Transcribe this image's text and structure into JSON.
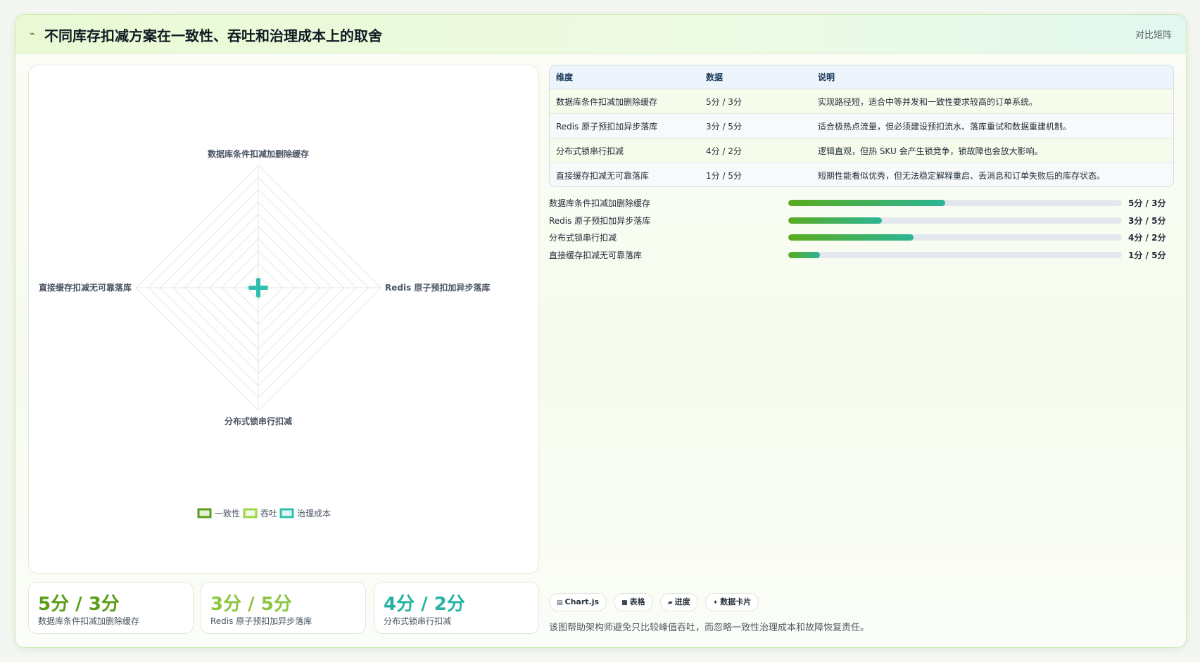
{
  "header": {
    "title_icon": "sparkline-icon",
    "title": "不同库存扣减方案在一致性、吞吐和治理成本上的取舍",
    "tag": "对比矩阵"
  },
  "colors": {
    "consistency": "#5a9e18",
    "throughput": "#9bd645",
    "cost": "#2fbfae",
    "accent": "#5aab1e"
  },
  "chart_data": {
    "type": "radar",
    "axes": [
      "数据库条件扣减加删除缓存",
      "Redis 原子预扣加异步落库",
      "分布式锁串行扣减",
      "直接缓存扣减无可靠落库"
    ],
    "series": [
      {
        "name": "一致性",
        "values": [
          0,
          0,
          0,
          0
        ]
      },
      {
        "name": "吞吐",
        "values": [
          0,
          0,
          0,
          0
        ]
      },
      {
        "name": "治理成本",
        "values": [
          0,
          0,
          0,
          0
        ]
      }
    ],
    "range": [
      0,
      5
    ],
    "grid": true,
    "legend": "bottom"
  },
  "kpis": [
    {
      "value": "5分 / 3分",
      "label": "数据库条件扣减加删除缓存",
      "color": "#5a9e18"
    },
    {
      "value": "3分 / 5分",
      "label": "Redis 原子预扣加异步落库",
      "color": "#8cc63f"
    },
    {
      "value": "4分 / 2分",
      "label": "分布式锁串行扣减",
      "color": "#26b3a3"
    }
  ],
  "table": {
    "headers": [
      "维度",
      "数据",
      "说明"
    ],
    "rows": [
      [
        "数据库条件扣减加删除缓存",
        "5分 / 3分",
        "实现路径短，适合中等并发和一致性要求较高的订单系统。"
      ],
      [
        "Redis 原子预扣加异步落库",
        "3分 / 5分",
        "适合极热点流量，但必须建设预扣流水、落库重试和数据重建机制。"
      ],
      [
        "分布式锁串行扣减",
        "4分 / 2分",
        "逻辑直观，但热 SKU 会产生锁竞争，锁故障也会放大影响。"
      ],
      [
        "直接缓存扣减无可靠落库",
        "1分 / 5分",
        "短期性能看似优秀，但无法稳定解释重启、丢消息和订单失败后的库存状态。"
      ]
    ]
  },
  "progress": [
    {
      "label": "数据库条件扣减加删除缓存",
      "value": "5分 / 3分",
      "fraction": 0.47
    },
    {
      "label": "Redis 原子预扣加异步落库",
      "value": "3分 / 5分",
      "fraction": 0.28
    },
    {
      "label": "分布式锁串行扣减",
      "value": "4分 / 2分",
      "fraction": 0.375
    },
    {
      "label": "直接缓存扣减无可靠落库",
      "value": "1分 / 5分",
      "fraction": 0.095
    }
  ],
  "chips": [
    {
      "icon": "chart-icon",
      "glyph": "▤",
      "label": "Chart.js"
    },
    {
      "icon": "table-icon",
      "glyph": "■",
      "label": "表格"
    },
    {
      "icon": "progress-icon",
      "glyph": "▰",
      "label": "进度"
    },
    {
      "icon": "data-card-icon",
      "glyph": "✦",
      "label": "数据卡片"
    }
  ],
  "footnote": "该图帮助架构师避免只比较峰值吞吐，而忽略一致性治理成本和故障恢复责任。"
}
